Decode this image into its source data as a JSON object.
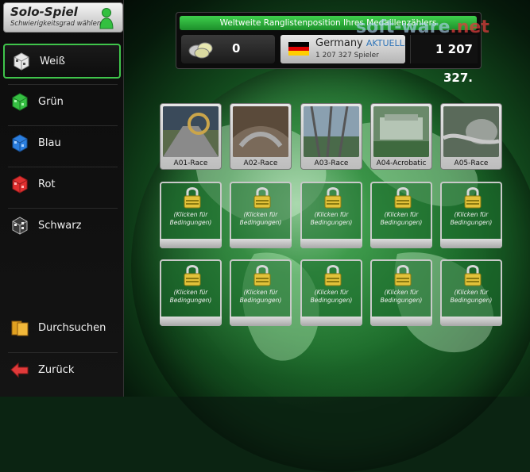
{
  "sidebar": {
    "title": "Solo-Spiel",
    "subtitle": "Schwierigkeitsgrad wählen",
    "items": [
      {
        "label": "Weiß",
        "icon": "white-cube-icon",
        "color": "#e8e8e8",
        "active": true
      },
      {
        "label": "Grün",
        "icon": "green-cube-icon",
        "color": "#36c043",
        "active": false
      },
      {
        "label": "Blau",
        "icon": "blue-cube-icon",
        "color": "#2b7fe0",
        "active": false
      },
      {
        "label": "Rot",
        "icon": "red-cube-icon",
        "color": "#e03030",
        "active": false
      },
      {
        "label": "Schwarz",
        "icon": "black-cube-icon",
        "color": "#333333",
        "active": false
      }
    ],
    "browse_label": "Durchsuchen",
    "back_label": "Zurück"
  },
  "ranking": {
    "title": "Weltweite Ranglistenposition Ihres Medaillenzählers",
    "medals": "0",
    "country": "Germany",
    "current_label": "AKTUELLE",
    "players": "1 207 327 Spieler",
    "position": "1 207 327."
  },
  "watermark": {
    "part1": "soft-ware",
    "part2": ".net"
  },
  "tracks": [
    {
      "name": "A01-Race"
    },
    {
      "name": "A02-Race"
    },
    {
      "name": "A03-Race"
    },
    {
      "name": "A04-Acrobatic"
    },
    {
      "name": "A05-Race"
    }
  ],
  "locked": {
    "condition_text": "(Klicken für Bedingungen)"
  },
  "colors": {
    "accent": "#3fc44b",
    "current_text": "#2f74b8"
  }
}
